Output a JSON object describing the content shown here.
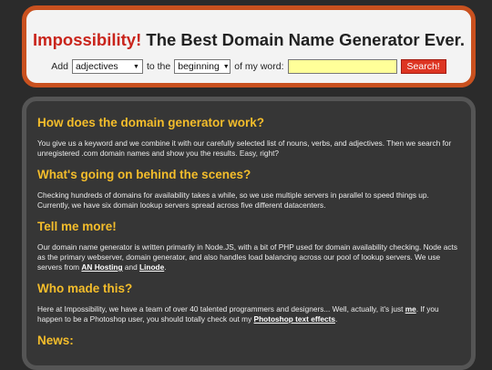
{
  "header": {
    "brand": "Impossibility!",
    "tagline": "The Best Domain Name Generator Ever.",
    "form": {
      "add_label": "Add",
      "word_type_selected": "adjectives",
      "to_the_label": "to the",
      "position_selected": "beginning",
      "of_my_word_label": "of my word:",
      "word_value": "",
      "search_label": "Search!"
    }
  },
  "sections": [
    {
      "heading": "How does the domain generator work?",
      "body": "You give us a keyword and we combine it with our carefully selected list of nouns, verbs, and adjectives. Then we search for unregistered .com domain names and show you the results. Easy, right?"
    },
    {
      "heading": "What's going on behind the scenes?",
      "body": "Checking hundreds of domains for availability takes a while, so we use multiple servers in parallel to speed things up. Currently, we have six domain lookup servers spread across five different datacenters."
    },
    {
      "heading": "Tell me more!",
      "body_parts": [
        "Our domain name generator is written primarily in Node.JS, with a bit of PHP used for domain availability checking. Node acts as the primary webserver, domain generator, and also handles load balancing across our pool of lookup servers. We use servers from ",
        "AN Hosting",
        " and ",
        "Linode",
        "."
      ]
    },
    {
      "heading": "Who made this?",
      "body_parts": [
        "Here at Impossibility, we have a team of over 40 talented programmers and designers... Well, actually, it's just ",
        "me",
        ". If you happen to be a Photoshop user, you should totally check out my ",
        "Photoshop text effects",
        "."
      ]
    },
    {
      "heading": "News:"
    }
  ]
}
